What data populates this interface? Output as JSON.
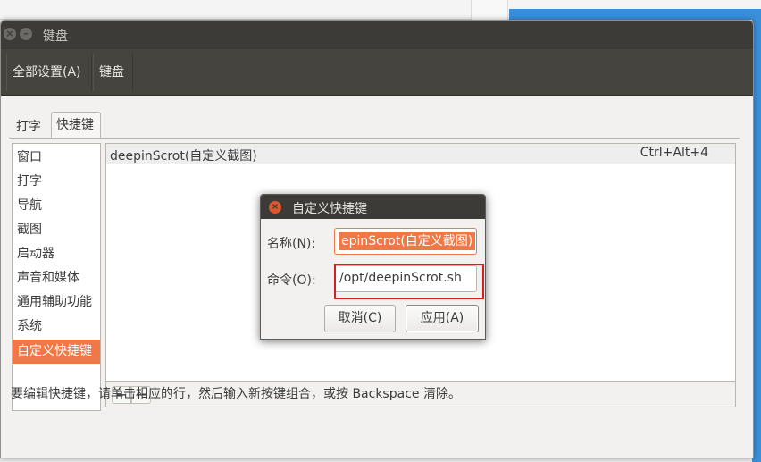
{
  "window": {
    "title": "键盘"
  },
  "navbar": {
    "all_settings": "全部设置(A)",
    "current": "键盘"
  },
  "tabs": [
    {
      "label": "打字",
      "active": false
    },
    {
      "label": "快捷键",
      "active": true
    }
  ],
  "sidebar": {
    "items": [
      {
        "label": "窗口"
      },
      {
        "label": "打字"
      },
      {
        "label": "导航"
      },
      {
        "label": "截图"
      },
      {
        "label": "启动器"
      },
      {
        "label": "声音和媒体"
      },
      {
        "label": "通用辅助功能"
      },
      {
        "label": "系统"
      },
      {
        "label": "自定义快捷键",
        "selected": true
      }
    ]
  },
  "shortcuts": {
    "rows": [
      {
        "name": "deepinScrot(自定义截图)",
        "accel": "Ctrl+Alt+4"
      }
    ],
    "add_label": "+",
    "remove_label": "−"
  },
  "hint": "要编辑快捷键，请单击相应的行，然后输入新按键组合，或按 Backspace 清除。",
  "dialog": {
    "title": "自定义快捷键",
    "name_label": "名称(N):",
    "name_value": "epinScrot(自定义截图)",
    "command_label": "命令(O):",
    "command_value": "/opt/deepinScrot.sh",
    "cancel": "取消(C)",
    "apply": "应用(A)"
  },
  "colors": {
    "accent": "#f07746",
    "titlebar": "#3d3b37",
    "highlight": "#d21f1f"
  }
}
